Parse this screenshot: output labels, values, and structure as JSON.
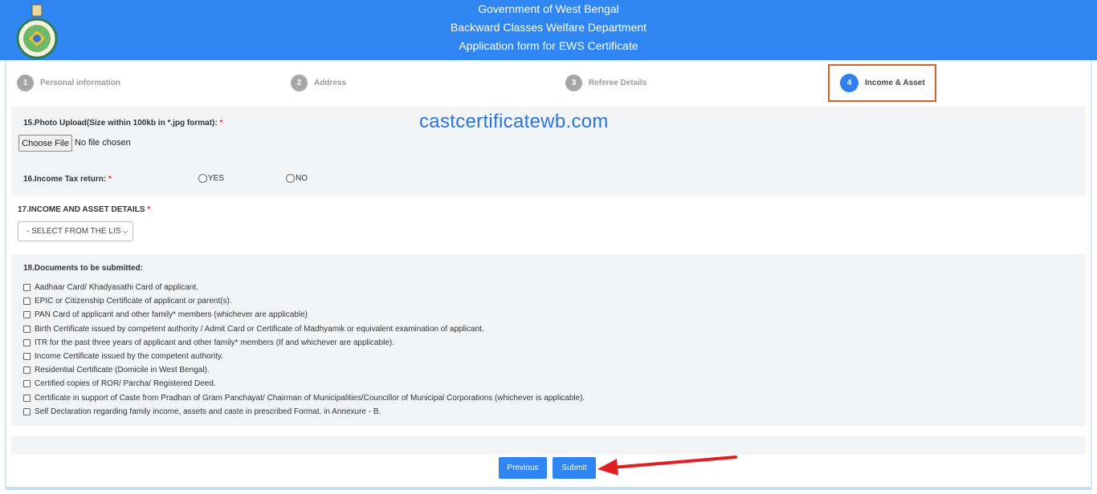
{
  "header": {
    "line1": "Government of West Bengal",
    "line2": "Backward Classes Welfare Department",
    "line3": "Application form for EWS Certificate",
    "logo_icon": "west-bengal-emblem-icon"
  },
  "steps": [
    {
      "num": "1",
      "label": "Personal information",
      "active": false
    },
    {
      "num": "2",
      "label": "Address",
      "active": false
    },
    {
      "num": "3",
      "label": "Referee Details",
      "active": false
    },
    {
      "num": "4",
      "label": "Income & Asset",
      "active": true
    }
  ],
  "watermark": "castcertificatewb.com",
  "photo": {
    "label": "15.Photo Upload(Size within 100kb in *.jpg format):",
    "required": "*",
    "button": "Choose File",
    "status": "No file chosen"
  },
  "itr": {
    "label": "16.Income Tax return:",
    "required": "*",
    "yes": "YES",
    "no": "NO"
  },
  "income": {
    "label": "17.INCOME AND ASSET DETAILS",
    "required": "*",
    "selected": "- SELECT FROM THE LIST -"
  },
  "documents": {
    "label": "18.Documents to be submitted:",
    "items": [
      "Aadhaar Card/ Khadyasathi Card of applicant.",
      "EPIC or Citizenship Certificate of applicant or parent(s).",
      "PAN Card of applicant and other family* members (whichever are applicable)",
      "Birth Certificate issued by competent authority / Admit Card or Certificate of Madhyamik or equivalent examination of applicant.",
      "ITR for the past three years of applicant and other family* members (If and whichever are applicable).",
      "Income Certificate issued by the competent authority.",
      "Residential Certificate (Domicile in West Bengal).",
      "Certified copies of ROR/ Parcha/ Registered Deed.",
      "Certificate in support of Caste from Pradhan of Gram Panchayat/ Chairman of Municipalities/Councillor of Municipal Corporations (whichever is applicable).",
      "Self Declaration regarding family income, assets and caste in prescribed Format. in Annexure - B."
    ]
  },
  "buttons": {
    "previous": "Previous",
    "submit": "Submit"
  },
  "colors": {
    "primary": "#2f86f2",
    "highlight": "#d0642a",
    "arrow": "#e02020"
  }
}
